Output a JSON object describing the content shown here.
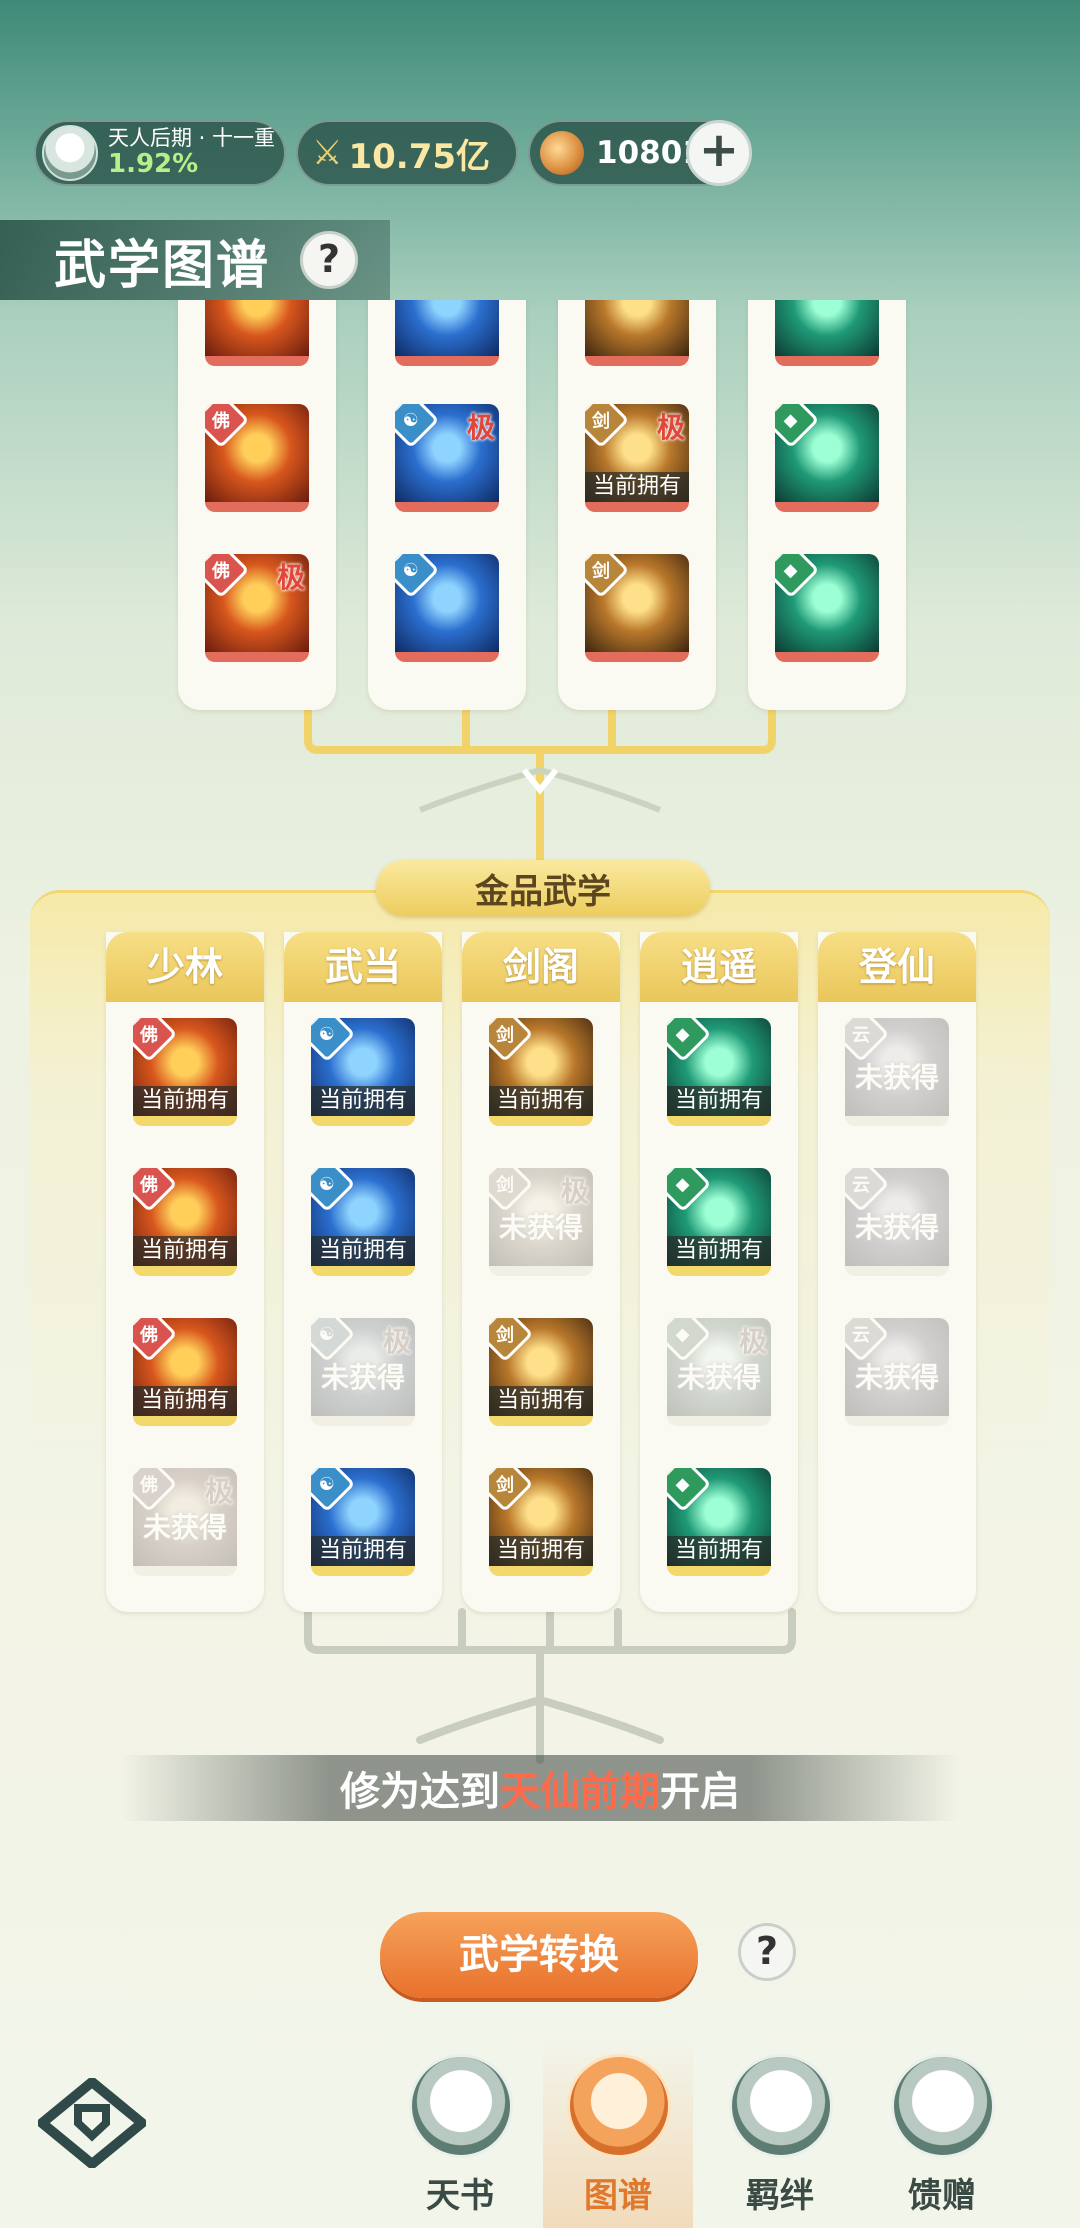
{
  "header": {
    "rank_name": "天人后期 · 十一重",
    "rank_progress": "1.92%",
    "power_value": "10.75亿",
    "coin_value": "10801"
  },
  "page": {
    "title": "武学图谱"
  },
  "upper_tiles": [
    [
      {
        "owned": false,
        "ji": false
      },
      {
        "owned": false,
        "ji": false
      },
      {
        "owned": false,
        "ji": true
      }
    ],
    [
      {
        "owned": false,
        "ji": false
      },
      {
        "owned": false,
        "ji": true
      },
      {
        "owned": false,
        "ji": false
      }
    ],
    [
      {
        "owned": false,
        "ji": false
      },
      {
        "owned": true,
        "ji": true
      },
      {
        "owned": false,
        "ji": false
      }
    ],
    [
      {
        "owned": false,
        "ji": false
      },
      {
        "owned": false,
        "ji": false
      },
      {
        "owned": false,
        "ji": false
      }
    ]
  ],
  "gold_section": {
    "banner": "金品武学",
    "sects": [
      {
        "name": "少林",
        "tiles": [
          {
            "owned": true
          },
          {
            "owned": true
          },
          {
            "owned": true
          },
          {
            "owned": false,
            "ji": true
          }
        ]
      },
      {
        "name": "武当",
        "tiles": [
          {
            "owned": true
          },
          {
            "owned": true
          },
          {
            "owned": false,
            "ji": true
          },
          {
            "owned": true
          }
        ]
      },
      {
        "name": "剑阁",
        "tiles": [
          {
            "owned": true
          },
          {
            "owned": false,
            "ji": true
          },
          {
            "owned": true
          },
          {
            "owned": true
          }
        ]
      },
      {
        "name": "逍遥",
        "tiles": [
          {
            "owned": true
          },
          {
            "owned": true
          },
          {
            "owned": false,
            "ji": true
          },
          {
            "owned": true
          }
        ]
      },
      {
        "name": "登仙",
        "tiles": [
          {
            "owned": false
          },
          {
            "owned": false
          },
          {
            "owned": false
          }
        ]
      }
    ],
    "owned_label": "当前拥有",
    "unowned_label": "未获得",
    "ji_label": "极"
  },
  "unlock_notice": {
    "prefix": "修为达到",
    "highlight": "天仙前期",
    "suffix": "开启"
  },
  "convert_button": "武学转换",
  "help_mark": "?",
  "nav": [
    {
      "label": "天书",
      "icon": "book-icon",
      "active": false
    },
    {
      "label": "图谱",
      "icon": "scroll-map-icon",
      "active": true
    },
    {
      "label": "羁绊",
      "icon": "handshake-icon",
      "active": false
    },
    {
      "label": "馈赠",
      "icon": "gift-icon",
      "active": false
    }
  ],
  "colors": {
    "shaolin": "#d9534f",
    "wudang": "#3a8fc8",
    "jiange": "#b8863a",
    "xiaoyao": "#2e9a5e",
    "dengxian": "#8a8a8a",
    "accent_orange": "#e8712c"
  }
}
